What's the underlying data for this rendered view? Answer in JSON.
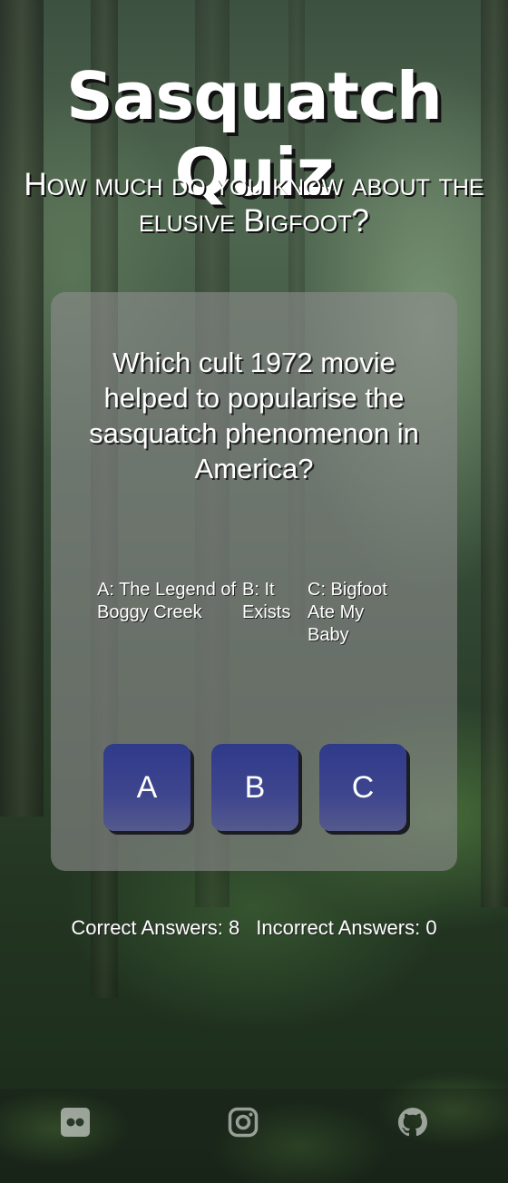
{
  "header": {
    "title": "Sasquatch Quiz",
    "subtitle": "How much do you know about the elusive Bigfoot?"
  },
  "quiz": {
    "question": "Which cult 1972 movie helped to popularise the sasquatch phenomenon in America?",
    "answers": {
      "a": "A: The Legend of Boggy Creek",
      "b": "B: It Exists",
      "c": "C: Bigfoot Ate My Baby"
    },
    "buttons": {
      "a": "A",
      "b": "B",
      "c": "C"
    }
  },
  "scores": {
    "correct": "Correct Answers: 8",
    "incorrect": "Incorrect Answers: 0"
  },
  "footer": {
    "icons": [
      "flickr-icon",
      "instagram-icon",
      "github-icon"
    ]
  },
  "colors": {
    "button": "#3a4288",
    "card": "#8c8c8c"
  }
}
